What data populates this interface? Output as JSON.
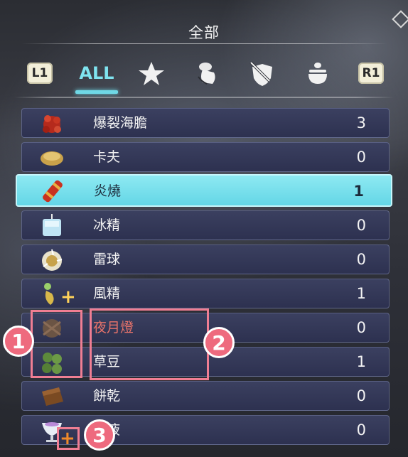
{
  "header": {
    "title": "全部"
  },
  "tabs": {
    "left_key": "L1",
    "right_key": "R1",
    "active_label": "ALL",
    "icons": [
      "star-icon",
      "hand-pouch-icon",
      "sword-shield-icon",
      "cauldron-icon"
    ]
  },
  "items": [
    {
      "name": "爆裂海膽",
      "count": "3",
      "icon": "urchin-icon"
    },
    {
      "name": "卡夫",
      "count": "0",
      "icon": "bread-icon"
    },
    {
      "name": "炎燒",
      "count": "1",
      "icon": "fire-stick-icon",
      "selected": true
    },
    {
      "name": "冰精",
      "count": "0",
      "icon": "ice-cube-icon"
    },
    {
      "name": "雷球",
      "count": "0",
      "icon": "thunder-ball-icon"
    },
    {
      "name": "風精",
      "count": "1",
      "icon": "wind-essence-icon"
    },
    {
      "name": "夜月燈",
      "count": "0",
      "icon": "moon-lamp-icon"
    },
    {
      "name": "草豆",
      "count": "1",
      "icon": "grass-bean-icon"
    },
    {
      "name": "餅乾",
      "count": "0",
      "icon": "cookie-icon"
    },
    {
      "name": "玉液",
      "count": "0",
      "icon": "jade-liquid-icon"
    }
  ],
  "annotations": {
    "badge1": "1",
    "badge2": "2",
    "badge3": "3"
  },
  "colors": {
    "accent": "#6fd8e6",
    "annotation": "#ee6a7e",
    "row_bg": "#343856"
  }
}
